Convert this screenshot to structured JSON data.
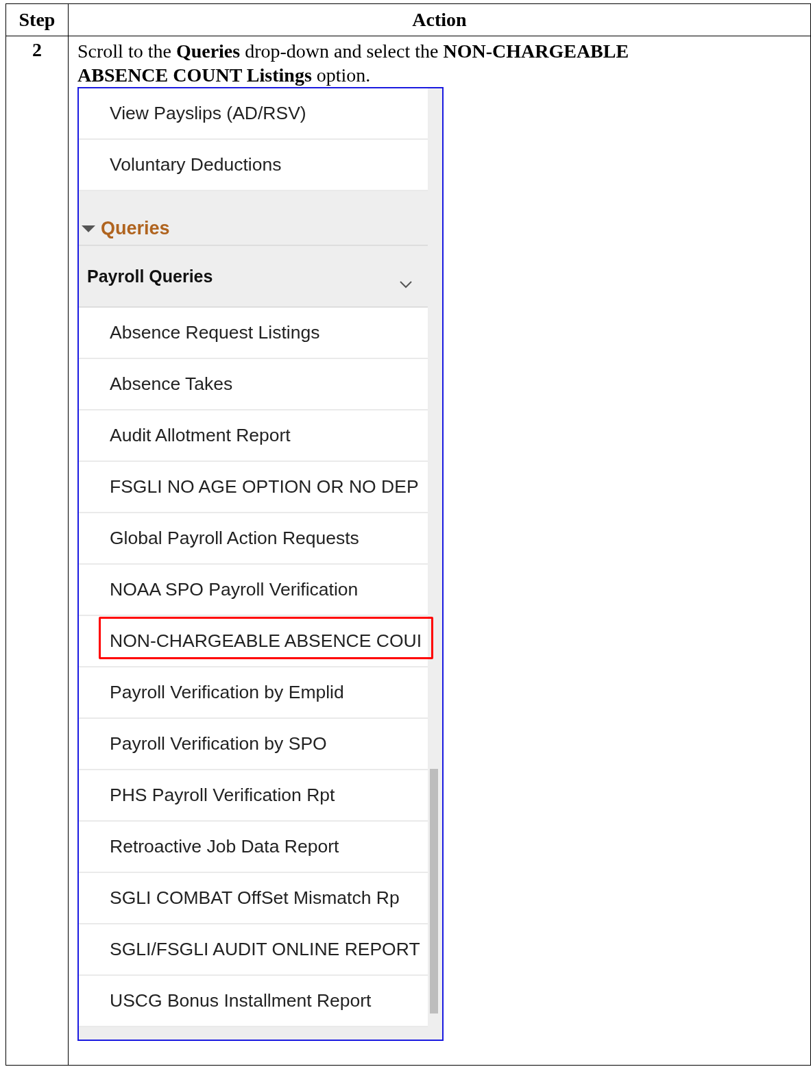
{
  "table": {
    "columns": [
      "Step",
      "Action"
    ],
    "rows": [
      {
        "step": "2",
        "instruction": "Scroll to the **Queries** drop-down and select the **NON-CHARGEABLE ABSENCE COUNT Listings** option.",
        "screenshot": {
          "items_above": [
            {
              "label": "View Payslips (AD/RSV)"
            },
            {
              "label": "Voluntary Deductions"
            }
          ],
          "section": {
            "title": "Queries",
            "expanded": true
          },
          "group": {
            "title": "Payroll Queries"
          },
          "items": [
            {
              "label": "Absence Request Listings",
              "highlighted": false
            },
            {
              "label": "Absence Takes",
              "highlighted": false
            },
            {
              "label": "Audit Allotment Report",
              "highlighted": false
            },
            {
              "label": "FSGLI NO AGE OPTION OR NO DEP",
              "highlighted": false
            },
            {
              "label": "Global Payroll Action Requests",
              "highlighted": false
            },
            {
              "label": "NOAA SPO Payroll Verification",
              "highlighted": false
            },
            {
              "label": "NON-CHARGEABLE ABSENCE COUI",
              "highlighted": true
            },
            {
              "label": "Payroll Verification by Emplid",
              "highlighted": false
            },
            {
              "label": "Payroll Verification by SPO",
              "highlighted": false
            },
            {
              "label": "PHS Payroll Verification Rpt",
              "highlighted": false
            },
            {
              "label": "Retroactive Job Data Report",
              "highlighted": false
            },
            {
              "label": "SGLI COMBAT OffSet Mismatch Rp",
              "highlighted": false
            },
            {
              "label": "SGLI/FSGLI AUDIT ONLINE REPORT",
              "highlighted": false
            },
            {
              "label": "USCG Bonus Installment Report",
              "highlighted": false
            }
          ]
        }
      }
    ]
  }
}
